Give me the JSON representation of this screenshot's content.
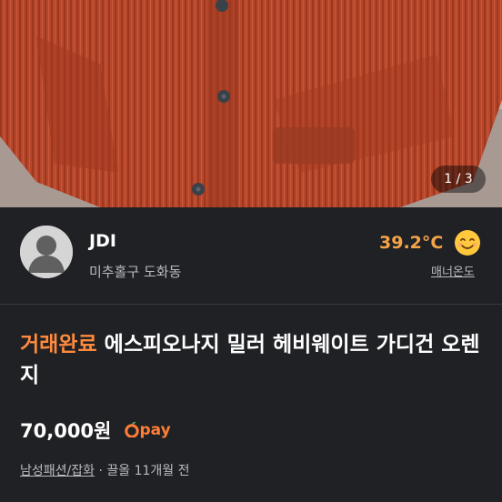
{
  "photo": {
    "counter": "1 / 3",
    "subject": "orange-knit-cardigan-photo"
  },
  "seller": {
    "name": "JDI",
    "location": "미추홀구 도화동",
    "temperature": "39.2°C",
    "temperature_value": 39.2,
    "manner_link": "매너온도"
  },
  "product": {
    "status": "거래완료",
    "title": "에스피오나지 밀러 헤비웨이트 가디건 오렌지",
    "price": "70,000원",
    "pay_label": "pay",
    "category": "남성패션/잡화",
    "separator": "·",
    "bump_time": "끌올 11개월 전"
  },
  "colors": {
    "background": "#202124",
    "accent_orange": "#ff8a3d",
    "temperature": "#f4a54a",
    "muted_text": "#b9bbbf",
    "cardigan": "#b8482c"
  }
}
